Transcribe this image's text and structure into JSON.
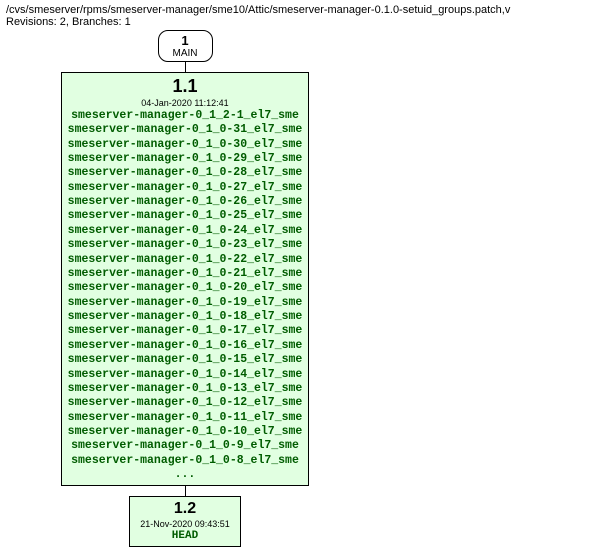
{
  "header": {
    "path": "/cvs/smeserver/rpms/smeserver-manager/sme10/Attic/smeserver-manager-0.1.0-setuid_groups.patch,v",
    "revline": "Revisions: 2, Branches: 1"
  },
  "branch": {
    "num": "1",
    "name": "MAIN"
  },
  "rev1": {
    "num": "1.1",
    "date": "04-Jan-2020 11:12:41",
    "tags": [
      "smeserver-manager-0_1_2-1_el7_sme",
      "smeserver-manager-0_1_0-31_el7_sme",
      "smeserver-manager-0_1_0-30_el7_sme",
      "smeserver-manager-0_1_0-29_el7_sme",
      "smeserver-manager-0_1_0-28_el7_sme",
      "smeserver-manager-0_1_0-27_el7_sme",
      "smeserver-manager-0_1_0-26_el7_sme",
      "smeserver-manager-0_1_0-25_el7_sme",
      "smeserver-manager-0_1_0-24_el7_sme",
      "smeserver-manager-0_1_0-23_el7_sme",
      "smeserver-manager-0_1_0-22_el7_sme",
      "smeserver-manager-0_1_0-21_el7_sme",
      "smeserver-manager-0_1_0-20_el7_sme",
      "smeserver-manager-0_1_0-19_el7_sme",
      "smeserver-manager-0_1_0-18_el7_sme",
      "smeserver-manager-0_1_0-17_el7_sme",
      "smeserver-manager-0_1_0-16_el7_sme",
      "smeserver-manager-0_1_0-15_el7_sme",
      "smeserver-manager-0_1_0-14_el7_sme",
      "smeserver-manager-0_1_0-13_el7_sme",
      "smeserver-manager-0_1_0-12_el7_sme",
      "smeserver-manager-0_1_0-11_el7_sme",
      "smeserver-manager-0_1_0-10_el7_sme",
      "smeserver-manager-0_1_0-9_el7_sme",
      "smeserver-manager-0_1_0-8_el7_sme"
    ],
    "ellipsis": "..."
  },
  "rev2": {
    "num": "1.2",
    "date": "21-Nov-2020 09:43:51",
    "head": "HEAD"
  }
}
